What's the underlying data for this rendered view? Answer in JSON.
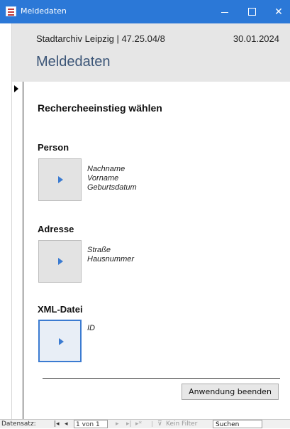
{
  "window": {
    "title": "Meldedaten"
  },
  "header": {
    "archive_line": "Stadtarchiv Leipzig | 47.25.04/8",
    "date": "30.01.2024",
    "form_title": "Meldedaten"
  },
  "main": {
    "title": "Rechercheeinstieg wählen",
    "sections": [
      {
        "label": "Person",
        "fields": [
          "Nachname",
          "Vorname",
          "Geburtsdatum"
        ]
      },
      {
        "label": "Adresse",
        "fields": [
          "Straße",
          "Hausnummer"
        ]
      },
      {
        "label": "XML-Datei",
        "fields": [
          "ID"
        ]
      }
    ],
    "end_button": "Anwendung beenden"
  },
  "statusbar": {
    "record_label": "Datensatz:",
    "first_icon": "first-record-icon",
    "prev_icon": "previous-record-icon",
    "record_value": "1 von 1",
    "next_icon": "next-record-icon",
    "last_icon": "last-record-icon",
    "new_icon": "new-record-icon",
    "filter_icon": "no-filter-icon",
    "filter_label": "Kein Filter",
    "search_value": "Suchen"
  },
  "colors": {
    "titlebar": "#2b78d7",
    "header_bg": "#e6e6e6",
    "form_title": "#3b5577",
    "accent": "#3b7bd1"
  }
}
